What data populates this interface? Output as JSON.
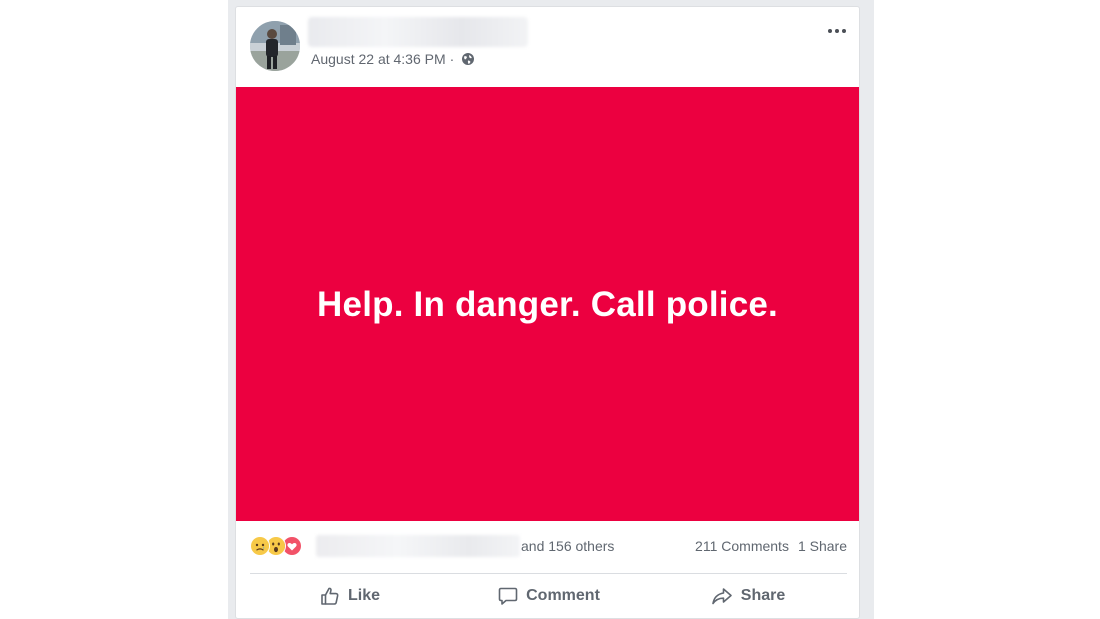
{
  "post": {
    "timestamp": "August 22 at 4:36 PM",
    "separator": "·",
    "privacy_icon": "globe-icon",
    "more_icon": "more-options-icon",
    "image_text": "Help. In danger. Call police.",
    "image_background": "#ec0040"
  },
  "reactions": {
    "icons": [
      "sad-reaction-icon",
      "wow-reaction-icon",
      "love-reaction-icon"
    ],
    "others_text": "and 156 others",
    "comments": "211 Comments",
    "shares": "1 Share"
  },
  "actions": {
    "like": "Like",
    "comment": "Comment",
    "share": "Share"
  }
}
